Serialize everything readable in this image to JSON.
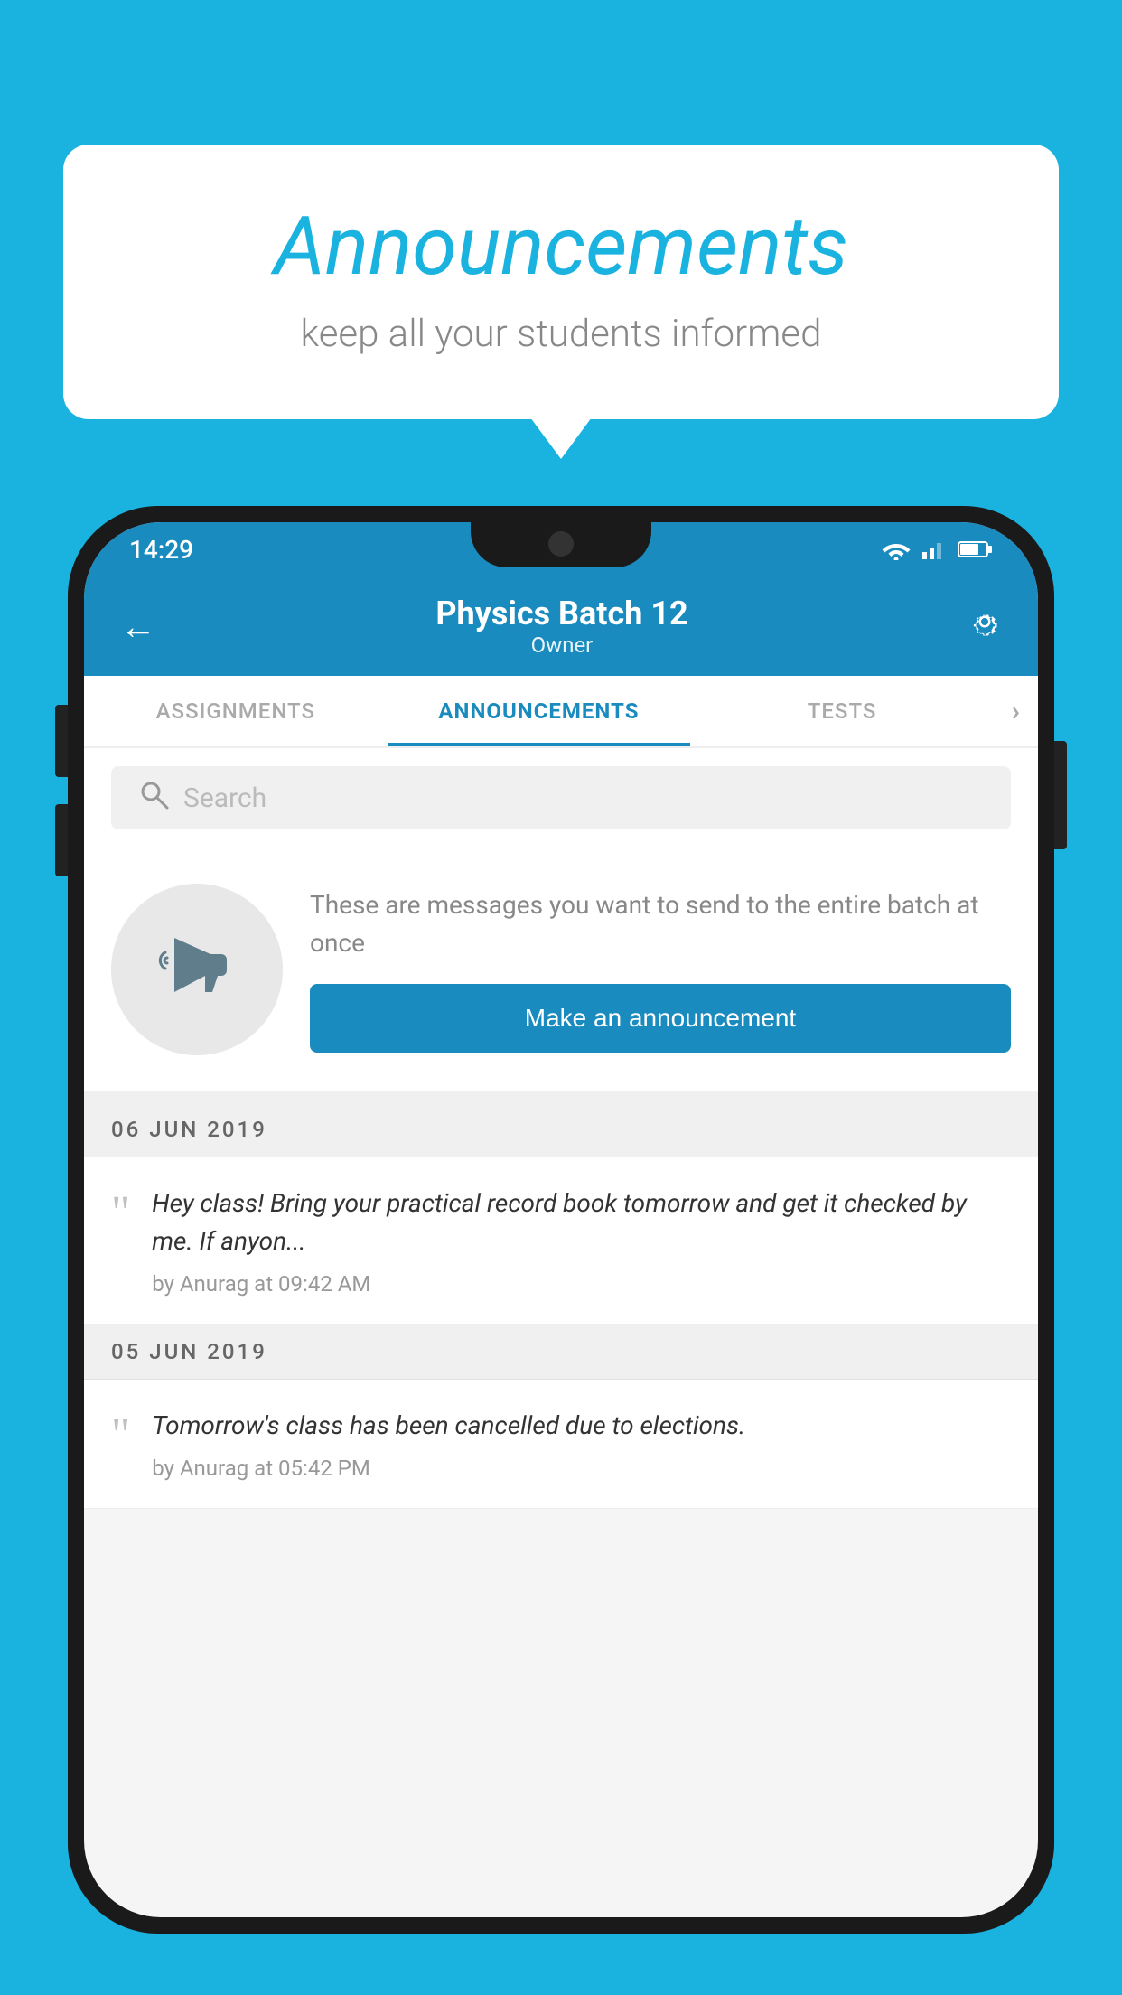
{
  "page": {
    "background_color": "#1ab3e0"
  },
  "speech_bubble": {
    "title": "Announcements",
    "subtitle": "keep all your students informed"
  },
  "phone": {
    "status_bar": {
      "time": "14:29"
    },
    "header": {
      "title": "Physics Batch 12",
      "subtitle": "Owner",
      "back_label": "←",
      "settings_label": "⚙"
    },
    "tabs": [
      {
        "label": "ASSIGNMENTS",
        "active": false
      },
      {
        "label": "ANNOUNCEMENTS",
        "active": true
      },
      {
        "label": "TESTS",
        "active": false
      }
    ],
    "tabs_more": ">",
    "search": {
      "placeholder": "Search"
    },
    "promo": {
      "description": "These are messages you want to send to the entire batch at once",
      "button_label": "Make an announcement"
    },
    "announcements": [
      {
        "date": "06  JUN  2019",
        "text": "Hey class! Bring your practical record book tomorrow and get it checked by me. If anyon...",
        "meta": "by Anurag at 09:42 AM"
      },
      {
        "date": "05  JUN  2019",
        "text": "Tomorrow's class has been cancelled due to elections.",
        "meta": "by Anurag at 05:42 PM"
      }
    ]
  }
}
